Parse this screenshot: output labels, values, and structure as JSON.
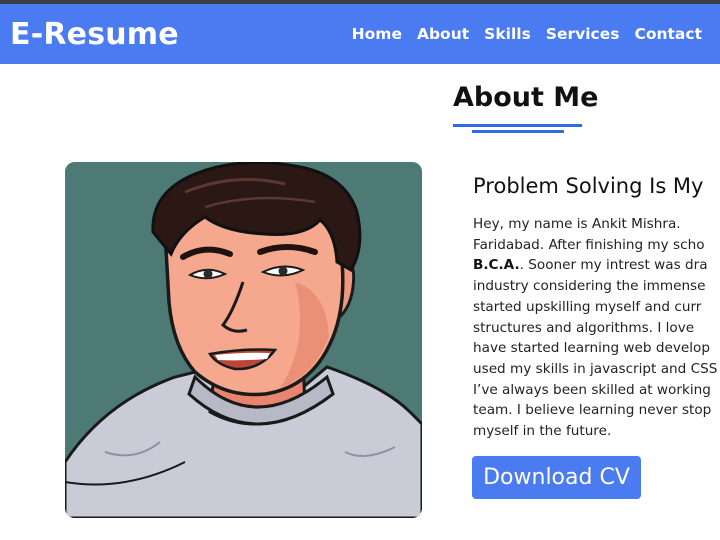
{
  "brand": "E-Resume",
  "nav": {
    "items": [
      "Home",
      "About",
      "Skills",
      "Services",
      "Contact"
    ]
  },
  "about": {
    "title": "About Me",
    "headline": "Problem Solving Is My",
    "bio": {
      "line1": "Hey, my name is Ankit Mishra.",
      "line2": "Faridabad. After finishing my scho",
      "degree": "B.C.A.",
      "line3_rest": ". Sooner my intrest was dra",
      "line4": "industry considering the immense",
      "line5": "started upskilling myself and curr",
      "line6": "structures and algorithms. I love",
      "line7": "have started learning web develop",
      "line8": "used my skills in javascript and CSS",
      "line9": "I’ve always been skilled at working",
      "line10": "team. I believe learning never stop",
      "line11": "myself in the future."
    },
    "download_label": "Download CV"
  },
  "colors": {
    "accent": "#4a7bf0",
    "underline": "#2f6be4",
    "photo_bg": "#4e7a76"
  }
}
